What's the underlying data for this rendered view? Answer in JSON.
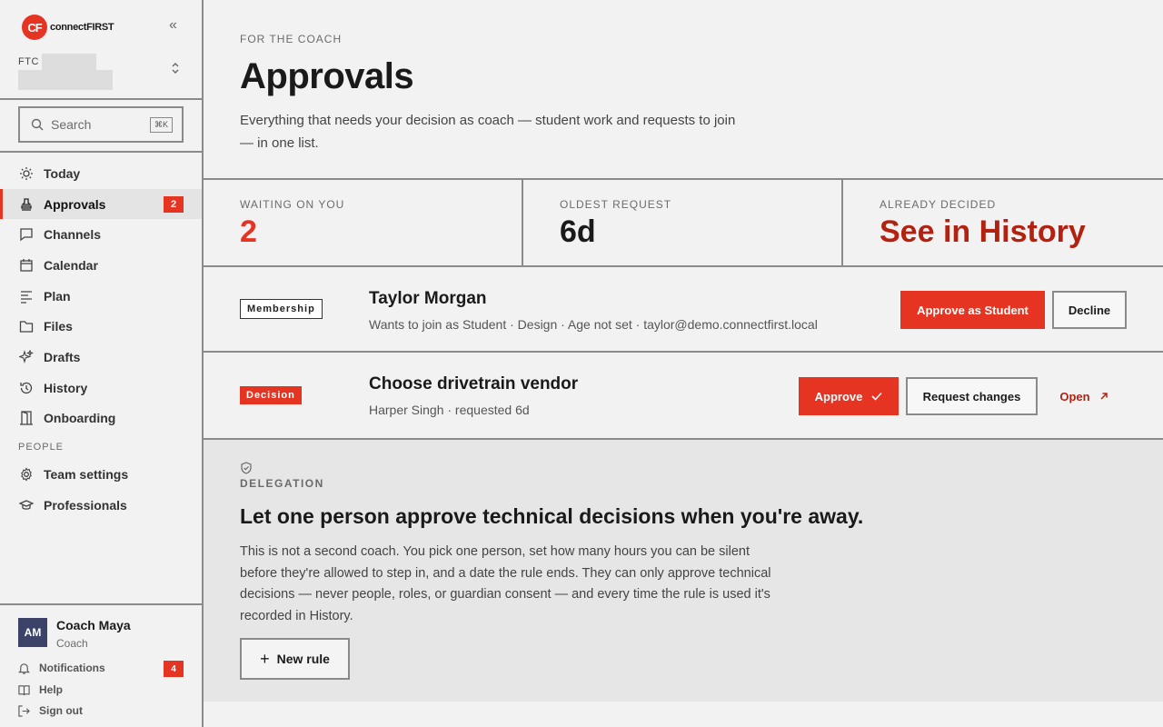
{
  "brand": {
    "logo_mark": "CF",
    "name": "connectFIRST",
    "accent": "#e63422"
  },
  "team": {
    "code": "FTC"
  },
  "search": {
    "placeholder": "Search",
    "shortcut": "⌘K"
  },
  "nav": {
    "items": [
      {
        "label": "Today",
        "icon": "sun-icon"
      },
      {
        "label": "Approvals",
        "icon": "stamp-icon",
        "badge": "2",
        "active": true
      },
      {
        "label": "Channels",
        "icon": "chat-icon"
      },
      {
        "label": "Calendar",
        "icon": "calendar-icon"
      },
      {
        "label": "Plan",
        "icon": "list-icon"
      },
      {
        "label": "Files",
        "icon": "folder-icon"
      },
      {
        "label": "Drafts",
        "icon": "sparkle-icon"
      },
      {
        "label": "History",
        "icon": "history-icon"
      },
      {
        "label": "Onboarding",
        "icon": "door-icon"
      }
    ],
    "people_label": "PEOPLE",
    "people_items": [
      {
        "label": "Team settings",
        "icon": "gear-icon"
      },
      {
        "label": "Professionals",
        "icon": "graduation-cap-icon"
      }
    ]
  },
  "user": {
    "initials": "AM",
    "name": "Coach Maya",
    "role": "Coach"
  },
  "footer": {
    "notifications": "Notifications",
    "notifications_badge": "4",
    "help": "Help",
    "sign_out": "Sign out"
  },
  "page": {
    "eyebrow": "FOR THE COACH",
    "title": "Approvals",
    "description": "Everything that needs your decision as coach — student work and requests to join — in one list."
  },
  "stats": [
    {
      "label": "WAITING ON YOU",
      "value": "2",
      "color": "#e63422"
    },
    {
      "label": "OLDEST REQUEST",
      "value": "6d",
      "color": "#1a1a1a"
    },
    {
      "label": "ALREADY DECIDED",
      "value": "See in History",
      "color": "#b32211"
    }
  ],
  "requests": [
    {
      "tag": "Membership",
      "title": "Taylor Morgan",
      "subtitle": "Wants to join as Student · Design · Age not set · taylor@demo.connectfirst.local",
      "primary": "Approve as Student",
      "secondary": "Decline"
    },
    {
      "tag": "Decision",
      "title": "Choose drivetrain vendor",
      "subtitle": "Harper Singh · requested 6d",
      "primary": "Approve",
      "secondary": "Request changes",
      "link": "Open"
    }
  ],
  "delegation": {
    "label": "DELEGATION",
    "title": "Let one person approve technical decisions when you're away.",
    "body": "This is not a second coach. You pick one person, set how many hours you can be silent before they're allowed to step in, and a date the rule ends. They can only approve technical decisions — never people, roles, or guardian consent — and every time the rule is used it's recorded in History.",
    "button": "New rule"
  }
}
